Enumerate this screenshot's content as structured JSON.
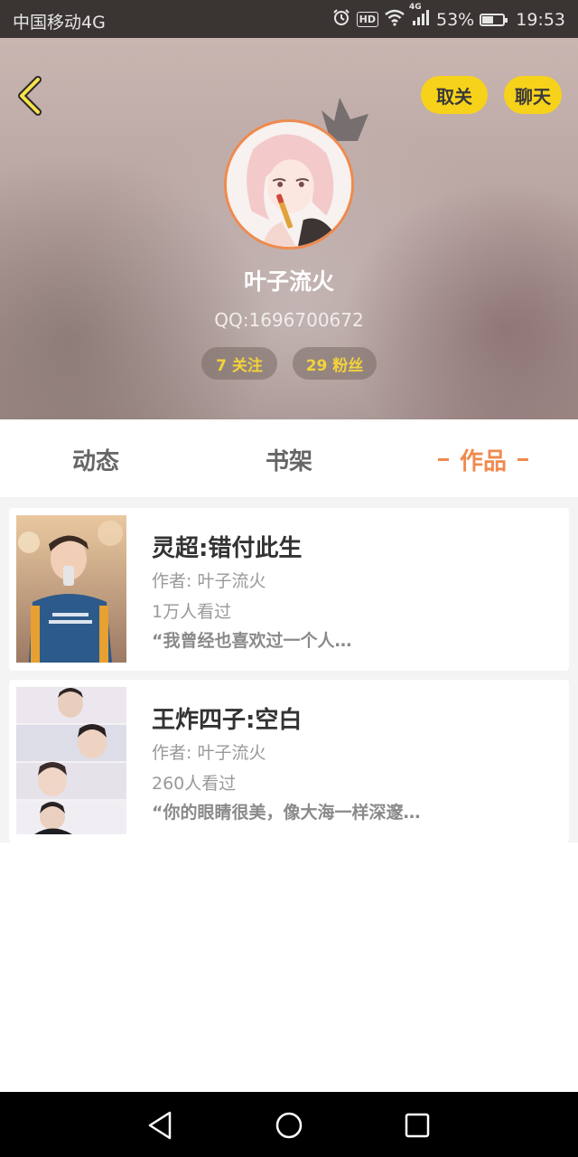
{
  "status_bar": {
    "carrier": "中国移动4G",
    "hd_badge": "HD",
    "network_type": "4G",
    "battery_percent": "53%",
    "battery_level": 0.53,
    "time": "19:53"
  },
  "header": {
    "unfollow_label": "取关",
    "chat_label": "聊天",
    "nickname": "叶子流火",
    "qq": "QQ:1696700672",
    "following": "7 关注",
    "fans": "29 粉丝"
  },
  "tabs": [
    {
      "label": "动态",
      "active": false
    },
    {
      "label": "书架",
      "active": false
    },
    {
      "label": "作品",
      "active": true
    }
  ],
  "works": [
    {
      "title": "灵超:错付此生",
      "author": "作者: 叶子流火",
      "views": "1万人看过",
      "excerpt": "“我曾经也喜欢过一个人…"
    },
    {
      "title": "王炸四子:空白",
      "author": "作者: 叶子流火",
      "views": "260人看过",
      "excerpt": "“你的眼睛很美，像大海一样深邃…"
    }
  ],
  "colors": {
    "accent": "#ef8a4e",
    "button_yellow": "#f7d21a",
    "stat_text": "#f4d23a"
  }
}
